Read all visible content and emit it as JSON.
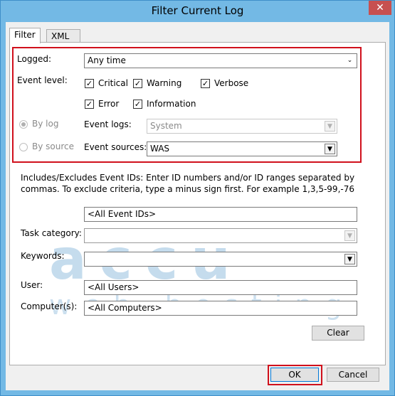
{
  "window": {
    "title": "Filter Current Log",
    "close_glyph": "✕"
  },
  "tabs": [
    {
      "label": "Filter"
    },
    {
      "label": "XML"
    }
  ],
  "filter": {
    "logged_label": "Logged:",
    "logged_value": "Any time",
    "event_level_label": "Event level:",
    "levels": {
      "critical": {
        "label": "Critical",
        "checked": true
      },
      "warning": {
        "label": "Warning",
        "checked": true
      },
      "verbose": {
        "label": "Verbose",
        "checked": true
      },
      "error": {
        "label": "Error",
        "checked": true
      },
      "information": {
        "label": "Information",
        "checked": true
      }
    },
    "by_log_label": "By log",
    "by_source_label": "By source",
    "event_logs_label": "Event logs:",
    "event_logs_value": "System",
    "event_sources_label": "Event sources:",
    "event_sources_value": "WAS",
    "description": "Includes/Excludes Event IDs: Enter ID numbers and/or ID ranges separated by commas. To exclude criteria, type a minus sign first. For example 1,3,5-99,-76",
    "event_ids_value": "<All Event IDs>",
    "task_category_label": "Task category:",
    "task_category_value": "",
    "keywords_label": "Keywords:",
    "keywords_value": "",
    "user_label": "User:",
    "user_value": "<All Users>",
    "computer_label": "Computer(s):",
    "computer_value": "<All Computers>",
    "clear_label": "Clear"
  },
  "footer": {
    "ok_label": "OK",
    "cancel_label": "Cancel"
  },
  "watermark": {
    "line1": "accu",
    "line2": "web hosting"
  },
  "colors": {
    "highlight_border": "#d0101c",
    "titlebar": "#73b9e5",
    "close": "#c75050"
  }
}
